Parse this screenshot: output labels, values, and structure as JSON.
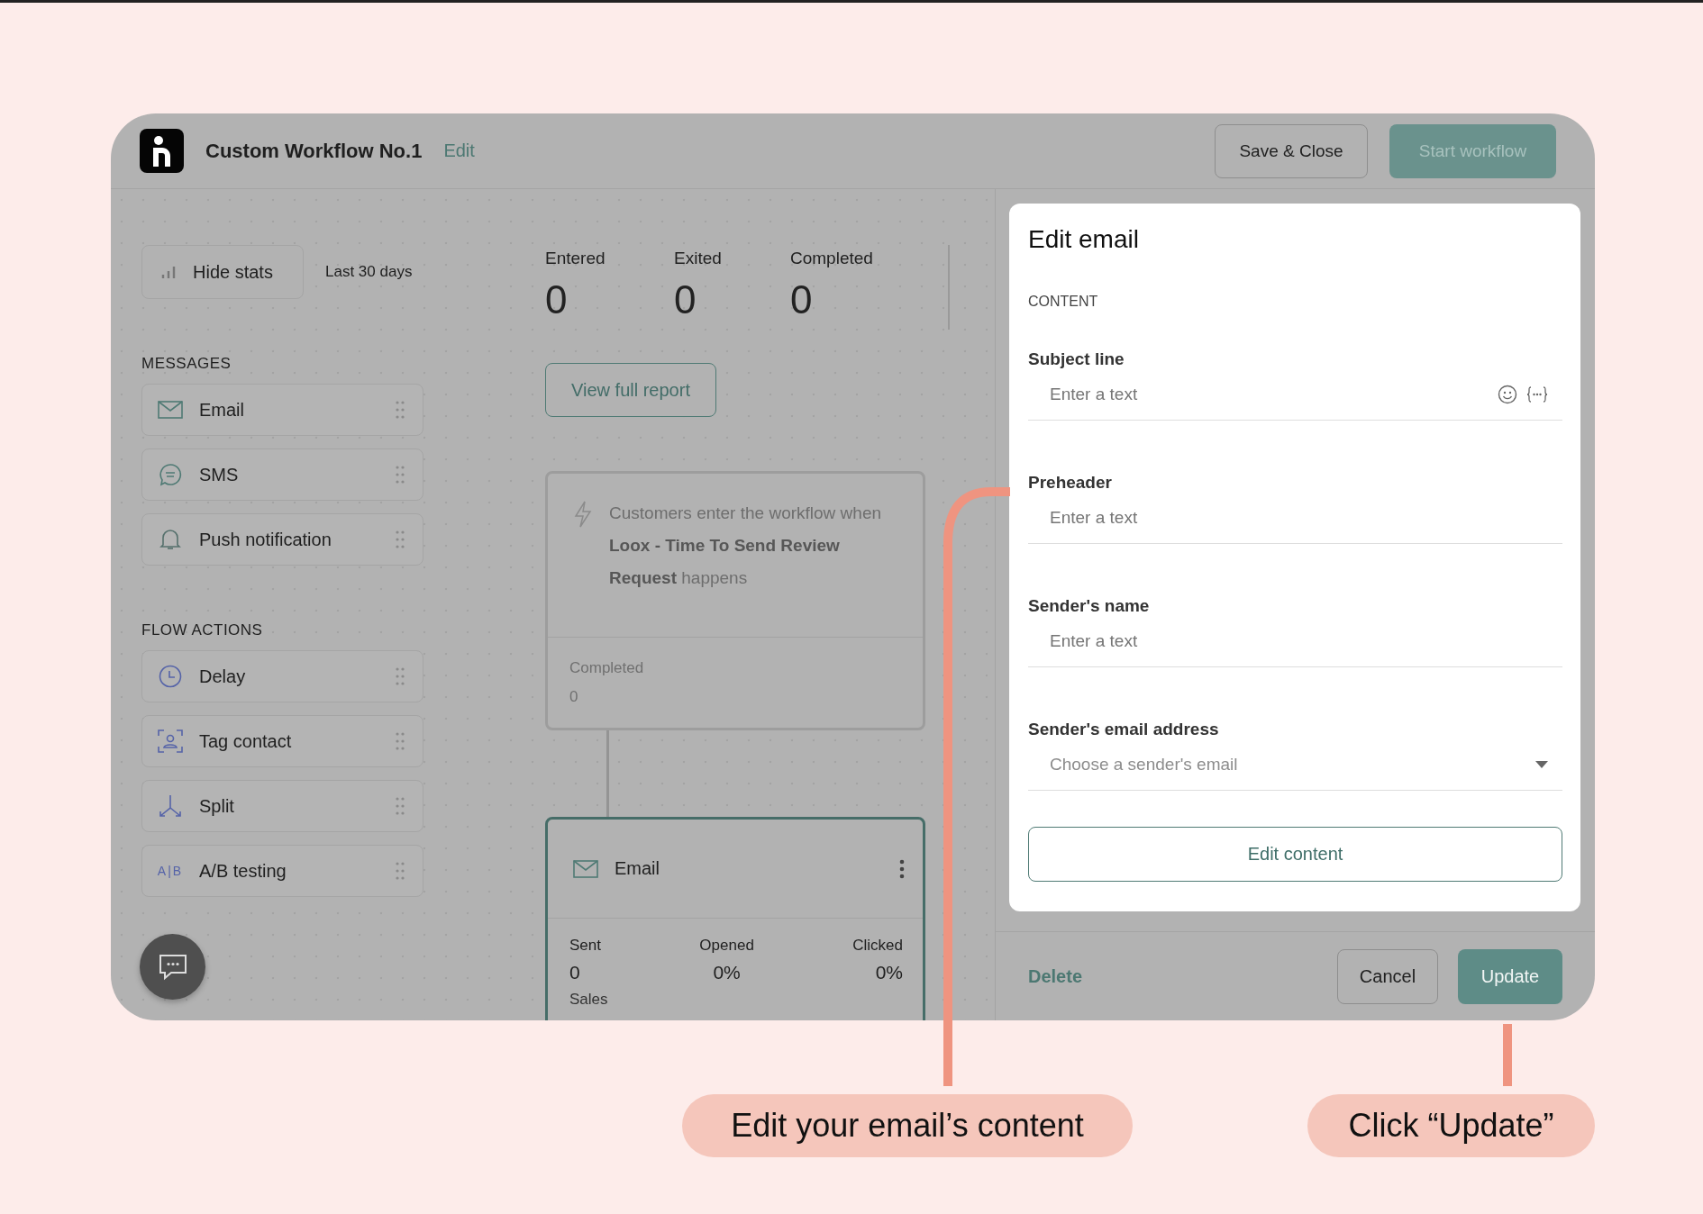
{
  "header": {
    "title": "Custom Workflow No.1",
    "edit_link": "Edit"
  },
  "header_buttons": [
    {
      "label": "Save & Close",
      "kind": "outline"
    },
    {
      "label": "Start workflow",
      "kind": "primary"
    }
  ],
  "stats_toggle": {
    "label": "Hide stats",
    "range": "Last 30 days"
  },
  "stats": [
    {
      "label": "Entered",
      "value": "0"
    },
    {
      "label": "Exited",
      "value": "0"
    },
    {
      "label": "Completed",
      "value": "0"
    }
  ],
  "report_button": "View full report",
  "palette": [
    {
      "title": "MESSAGES",
      "items": [
        {
          "label": "Email",
          "kind": "email"
        },
        {
          "label": "SMS",
          "kind": "sms"
        },
        {
          "label": "Push notification",
          "kind": "push"
        }
      ]
    },
    {
      "title": "FLOW ACTIONS",
      "items": [
        {
          "label": "Delay",
          "kind": "delay"
        },
        {
          "label": "Tag contact",
          "kind": "tag"
        },
        {
          "label": "Split",
          "kind": "split"
        },
        {
          "label": "A/B testing",
          "kind": "ab",
          "icon_text": "A|B"
        }
      ]
    }
  ],
  "trigger_card": {
    "text": "Customers enter the workflow when **Loox - Time To Send Review Request** happens",
    "stat_label": "Completed",
    "stat_value": "0"
  },
  "email_node": {
    "title": "Email",
    "stats": [
      {
        "label": "Sent",
        "value": "0"
      },
      {
        "label": "Opened",
        "value": "0%"
      },
      {
        "label": "Clicked",
        "value": "0%"
      }
    ],
    "next_label": "Sales"
  },
  "edit_panel": {
    "title": "Edit email",
    "section": "CONTENT",
    "fields": [
      {
        "label": "Subject line",
        "placeholder": "Enter a text",
        "kind": "text-tools"
      },
      {
        "label": "Preheader",
        "placeholder": "Enter a text",
        "kind": "text"
      },
      {
        "label": "Sender's name",
        "placeholder": "Enter a text",
        "kind": "text"
      },
      {
        "label": "Sender's email address",
        "placeholder": "Choose a sender's email",
        "kind": "select"
      }
    ],
    "content_button": "Edit content",
    "delete_link": "Delete",
    "buttons": [
      {
        "label": "Cancel",
        "kind": "outline"
      },
      {
        "label": "Update",
        "kind": "primary"
      }
    ]
  },
  "callouts": [
    "Edit your email’s content",
    "Click “Update”"
  ]
}
